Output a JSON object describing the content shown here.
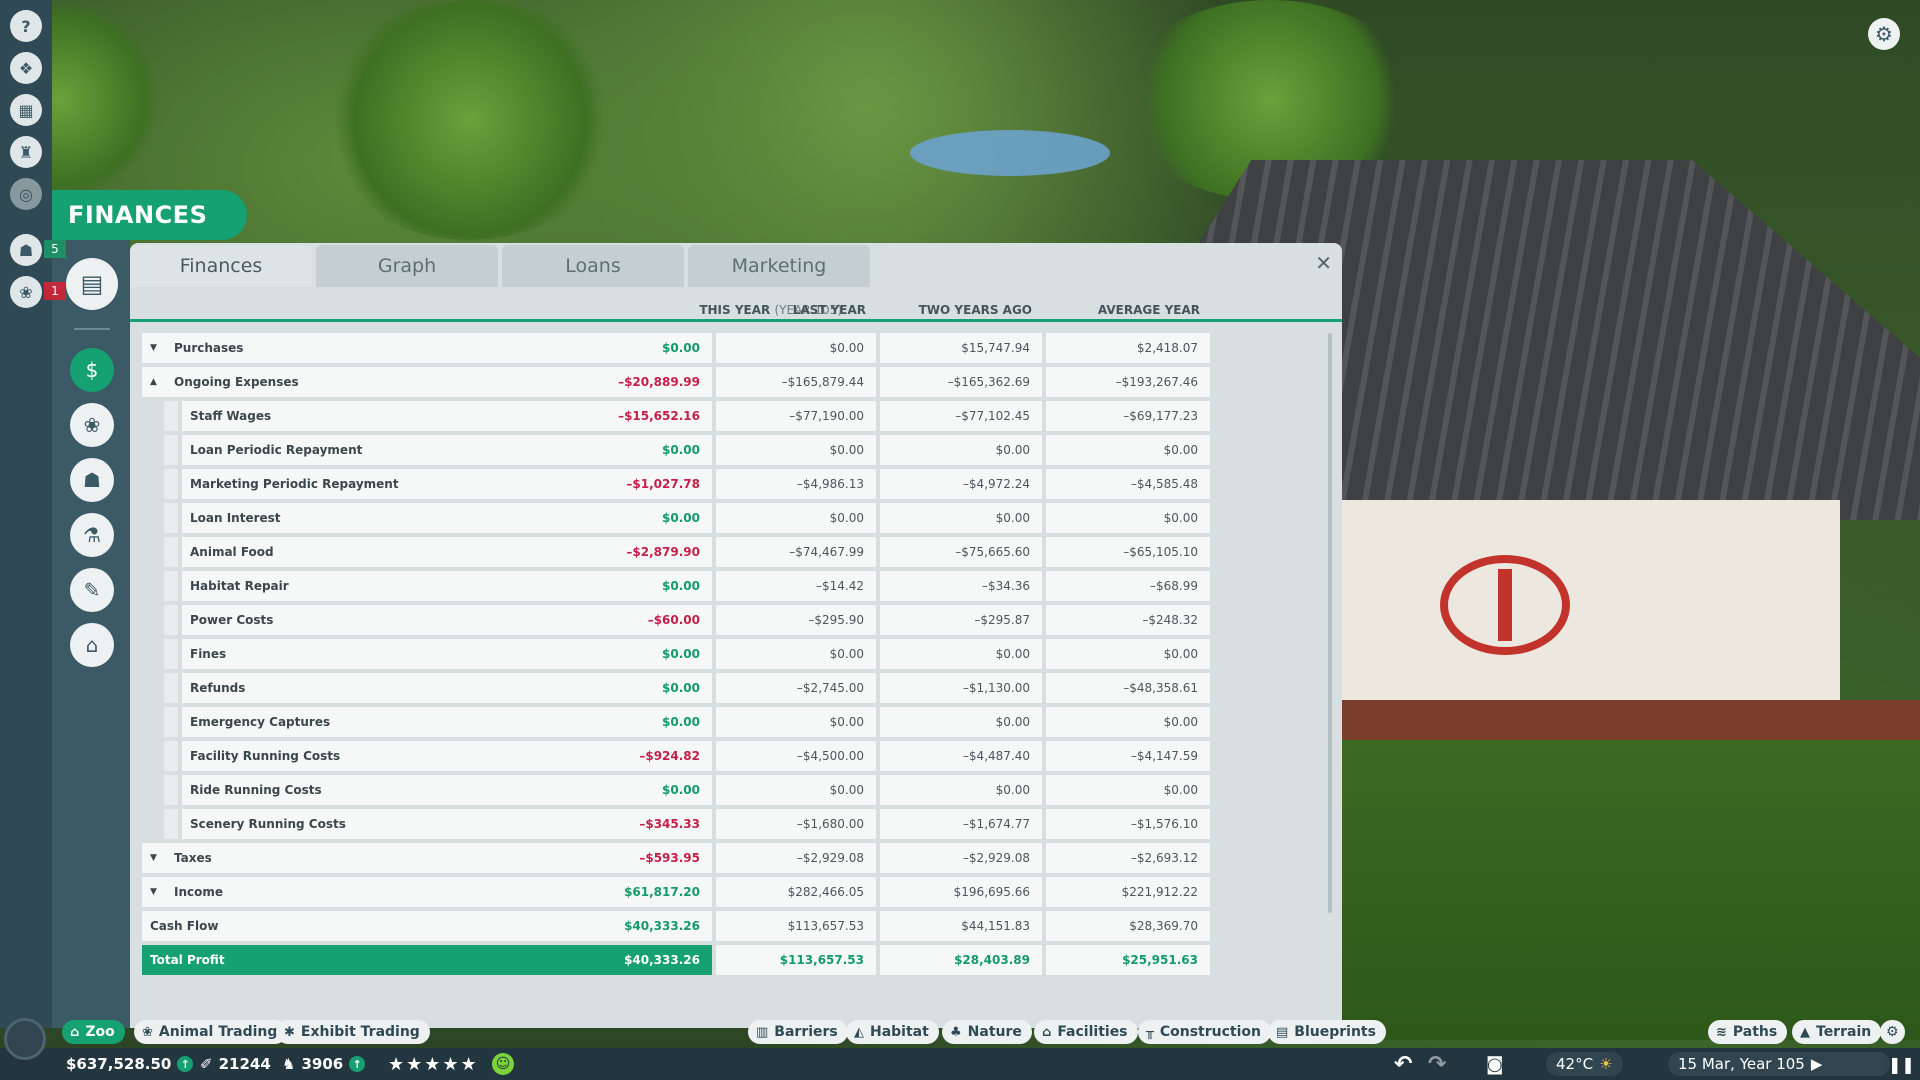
{
  "panel": {
    "title": "FINANCES",
    "tabs": [
      "Finances",
      "Graph",
      "Loans",
      "Marketing"
    ],
    "active_tab": "Finances",
    "columns": {
      "this_year": "THIS YEAR",
      "this_year_sub": "(YEAR 105)",
      "last_year": "LAST YEAR",
      "two_years_ago": "TWO YEARS AGO",
      "average_year": "AVERAGE YEAR"
    },
    "rows": [
      {
        "label": "Purchases",
        "this": "$0.00",
        "sign": "pos",
        "last": "$0.00",
        "two": "$15,747.94",
        "avg": "$2,418.07",
        "kind": "group",
        "caret": "▼"
      },
      {
        "label": "Ongoing Expenses",
        "this": "–$20,889.99",
        "sign": "neg",
        "last": "–$165,879.44",
        "two": "–$165,362.69",
        "avg": "–$193,267.46",
        "kind": "group",
        "caret": "▲"
      },
      {
        "label": "Staff Wages",
        "this": "–$15,652.16",
        "sign": "neg",
        "last": "–$77,190.00",
        "two": "–$77,102.45",
        "avg": "–$69,177.23",
        "kind": "sub"
      },
      {
        "label": "Loan Periodic Repayment",
        "this": "$0.00",
        "sign": "pos",
        "last": "$0.00",
        "two": "$0.00",
        "avg": "$0.00",
        "kind": "sub"
      },
      {
        "label": "Marketing Periodic Repayment",
        "this": "–$1,027.78",
        "sign": "neg",
        "last": "–$4,986.13",
        "two": "–$4,972.24",
        "avg": "–$4,585.48",
        "kind": "sub"
      },
      {
        "label": "Loan Interest",
        "this": "$0.00",
        "sign": "pos",
        "last": "$0.00",
        "two": "$0.00",
        "avg": "$0.00",
        "kind": "sub"
      },
      {
        "label": "Animal Food",
        "this": "–$2,879.90",
        "sign": "neg",
        "last": "–$74,467.99",
        "two": "–$75,665.60",
        "avg": "–$65,105.10",
        "kind": "sub"
      },
      {
        "label": "Habitat Repair",
        "this": "$0.00",
        "sign": "pos",
        "last": "–$14.42",
        "two": "–$34.36",
        "avg": "–$68.99",
        "kind": "sub"
      },
      {
        "label": "Power Costs",
        "this": "–$60.00",
        "sign": "neg",
        "last": "–$295.90",
        "two": "–$295.87",
        "avg": "–$248.32",
        "kind": "sub"
      },
      {
        "label": "Fines",
        "this": "$0.00",
        "sign": "pos",
        "last": "$0.00",
        "two": "$0.00",
        "avg": "$0.00",
        "kind": "sub"
      },
      {
        "label": "Refunds",
        "this": "$0.00",
        "sign": "pos",
        "last": "–$2,745.00",
        "two": "–$1,130.00",
        "avg": "–$48,358.61",
        "kind": "sub"
      },
      {
        "label": "Emergency Captures",
        "this": "$0.00",
        "sign": "pos",
        "last": "$0.00",
        "two": "$0.00",
        "avg": "$0.00",
        "kind": "sub"
      },
      {
        "label": "Facility Running Costs",
        "this": "–$924.82",
        "sign": "neg",
        "last": "–$4,500.00",
        "two": "–$4,487.40",
        "avg": "–$4,147.59",
        "kind": "sub"
      },
      {
        "label": "Ride Running Costs",
        "this": "$0.00",
        "sign": "pos",
        "last": "$0.00",
        "two": "$0.00",
        "avg": "$0.00",
        "kind": "sub"
      },
      {
        "label": "Scenery Running Costs",
        "this": "–$345.33",
        "sign": "neg",
        "last": "–$1,680.00",
        "two": "–$1,674.77",
        "avg": "–$1,576.10",
        "kind": "sub"
      },
      {
        "label": "Taxes",
        "this": "–$593.95",
        "sign": "neg",
        "last": "–$2,929.08",
        "two": "–$2,929.08",
        "avg": "–$2,693.12",
        "kind": "group",
        "caret": "▼"
      },
      {
        "label": "Income",
        "this": "$61,817.20",
        "sign": "pos",
        "last": "$282,466.05",
        "two": "$196,695.66",
        "avg": "$221,912.22",
        "kind": "group",
        "caret": "▼"
      },
      {
        "label": "Cash Flow",
        "this": "$40,333.26",
        "sign": "pos",
        "last": "$113,657.53",
        "two": "$44,151.83",
        "avg": "$28,369.70",
        "kind": "plain"
      },
      {
        "label": "Total Profit",
        "this": "$40,333.26",
        "sign": "pos",
        "last": "$113,657.53",
        "two": "$28,403.89",
        "avg": "$25,951.63",
        "kind": "total"
      }
    ]
  },
  "left_badges": {
    "staff": "5",
    "animals": "1"
  },
  "toolbar": {
    "left": [
      {
        "label": "Zoo",
        "icon": "zoo-icon",
        "active": true
      },
      {
        "label": "Animal Trading",
        "icon": "paw-icon"
      },
      {
        "label": "Exhibit Trading",
        "icon": "exhibit-icon"
      }
    ],
    "center": [
      {
        "label": "Barriers",
        "icon": "barrier-icon"
      },
      {
        "label": "Habitat",
        "icon": "habitat-icon"
      },
      {
        "label": "Nature",
        "icon": "tree-icon"
      },
      {
        "label": "Facilities",
        "icon": "facility-icon"
      },
      {
        "label": "Construction",
        "icon": "construction-icon"
      },
      {
        "label": "Blueprints",
        "icon": "blueprint-icon"
      }
    ],
    "right": [
      {
        "label": "Paths",
        "icon": "path-icon"
      },
      {
        "label": "Terrain",
        "icon": "terrain-icon"
      }
    ]
  },
  "status": {
    "money": "$637,528.50",
    "guests_rating": "21244",
    "guests": "3906",
    "temperature": "42°C",
    "date": "15 Mar, Year 105"
  }
}
